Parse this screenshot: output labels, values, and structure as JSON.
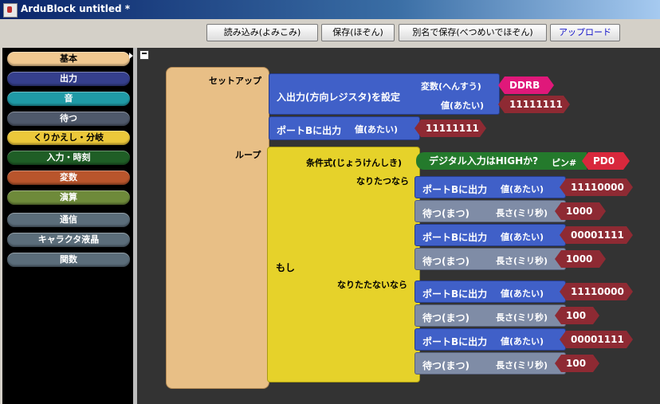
{
  "window": {
    "title": "ArduBlock untitled *"
  },
  "toolbar": {
    "open": "読み込み(よみこみ)",
    "save": "保存(ほぞん)",
    "save_as": "別名で保存(べつめいでほぞん)",
    "upload": "アップロード"
  },
  "palette": [
    {
      "label": "基本",
      "color": "#f0c890"
    },
    {
      "label": "出力",
      "color": "#353f8c"
    },
    {
      "label": "音",
      "color": "#1f9aa6"
    },
    {
      "label": "待つ",
      "color": "#4f596b"
    },
    {
      "label": "くりかえし・分岐",
      "color": "#ecc83a"
    },
    {
      "label": "入力・時刻",
      "color": "#1f5e26"
    },
    {
      "label": "変数",
      "color": "#b9552c"
    },
    {
      "label": "演算",
      "color": "#6e8a3a"
    },
    {
      "label": "通信",
      "color": "#5b6d7a"
    },
    {
      "label": "キャラクタ液晶",
      "color": "#5b6d7a"
    },
    {
      "label": "関数",
      "color": "#5b6d7a"
    }
  ],
  "program": {
    "setup_label": "セットアップ",
    "loop_label": "ループ",
    "io_block": {
      "label": "入出力(方向レジスタ)を設定",
      "var_label": "変数(へんすう)",
      "value_label": "値(あたい)",
      "var_value": "DDRB",
      "value": "11111111"
    },
    "portb_setup": {
      "label": "ポートBに出力",
      "value_label": "値(あたい)",
      "value": "11111111"
    },
    "if_block": {
      "label": "もし",
      "condition_label": "条件式(じょうけんしき)",
      "then_label": "なりたつなら",
      "else_label": "なりたたないなら",
      "condition": {
        "label": "デジタル入力はHIGHか?",
        "pin_label": "ピン#",
        "pin": "PD0"
      }
    },
    "then_blocks": [
      {
        "type": "portb",
        "label": "ポートBに出力",
        "param": "値(あたい)",
        "value": "11110000"
      },
      {
        "type": "wait",
        "label": "待つ(まつ)",
        "param": "長さ(ミリ秒)",
        "value": "1000"
      },
      {
        "type": "portb",
        "label": "ポートBに出力",
        "param": "値(あたい)",
        "value": "00001111"
      },
      {
        "type": "wait",
        "label": "待つ(まつ)",
        "param": "長さ(ミリ秒)",
        "value": "1000"
      }
    ],
    "else_blocks": [
      {
        "type": "portb",
        "label": "ポートBに出力",
        "param": "値(あたい)",
        "value": "11110000"
      },
      {
        "type": "wait",
        "label": "待つ(まつ)",
        "param": "長さ(ミリ秒)",
        "value": "100"
      },
      {
        "type": "portb",
        "label": "ポートBに出力",
        "param": "値(あたい)",
        "value": "00001111"
      },
      {
        "type": "wait",
        "label": "待つ(まつ)",
        "param": "長さ(ミリ秒)",
        "value": "100"
      }
    ]
  },
  "colors": {
    "block_blue": "#4060c8",
    "block_gray": "#7f8ca6",
    "block_yellow": "#e6d22a",
    "block_tan": "#e8bf86",
    "value_dark_red": "#8e2a33",
    "value_pink": "#e0187a",
    "value_red": "#d8283c",
    "condition_green": "#247a2c"
  }
}
